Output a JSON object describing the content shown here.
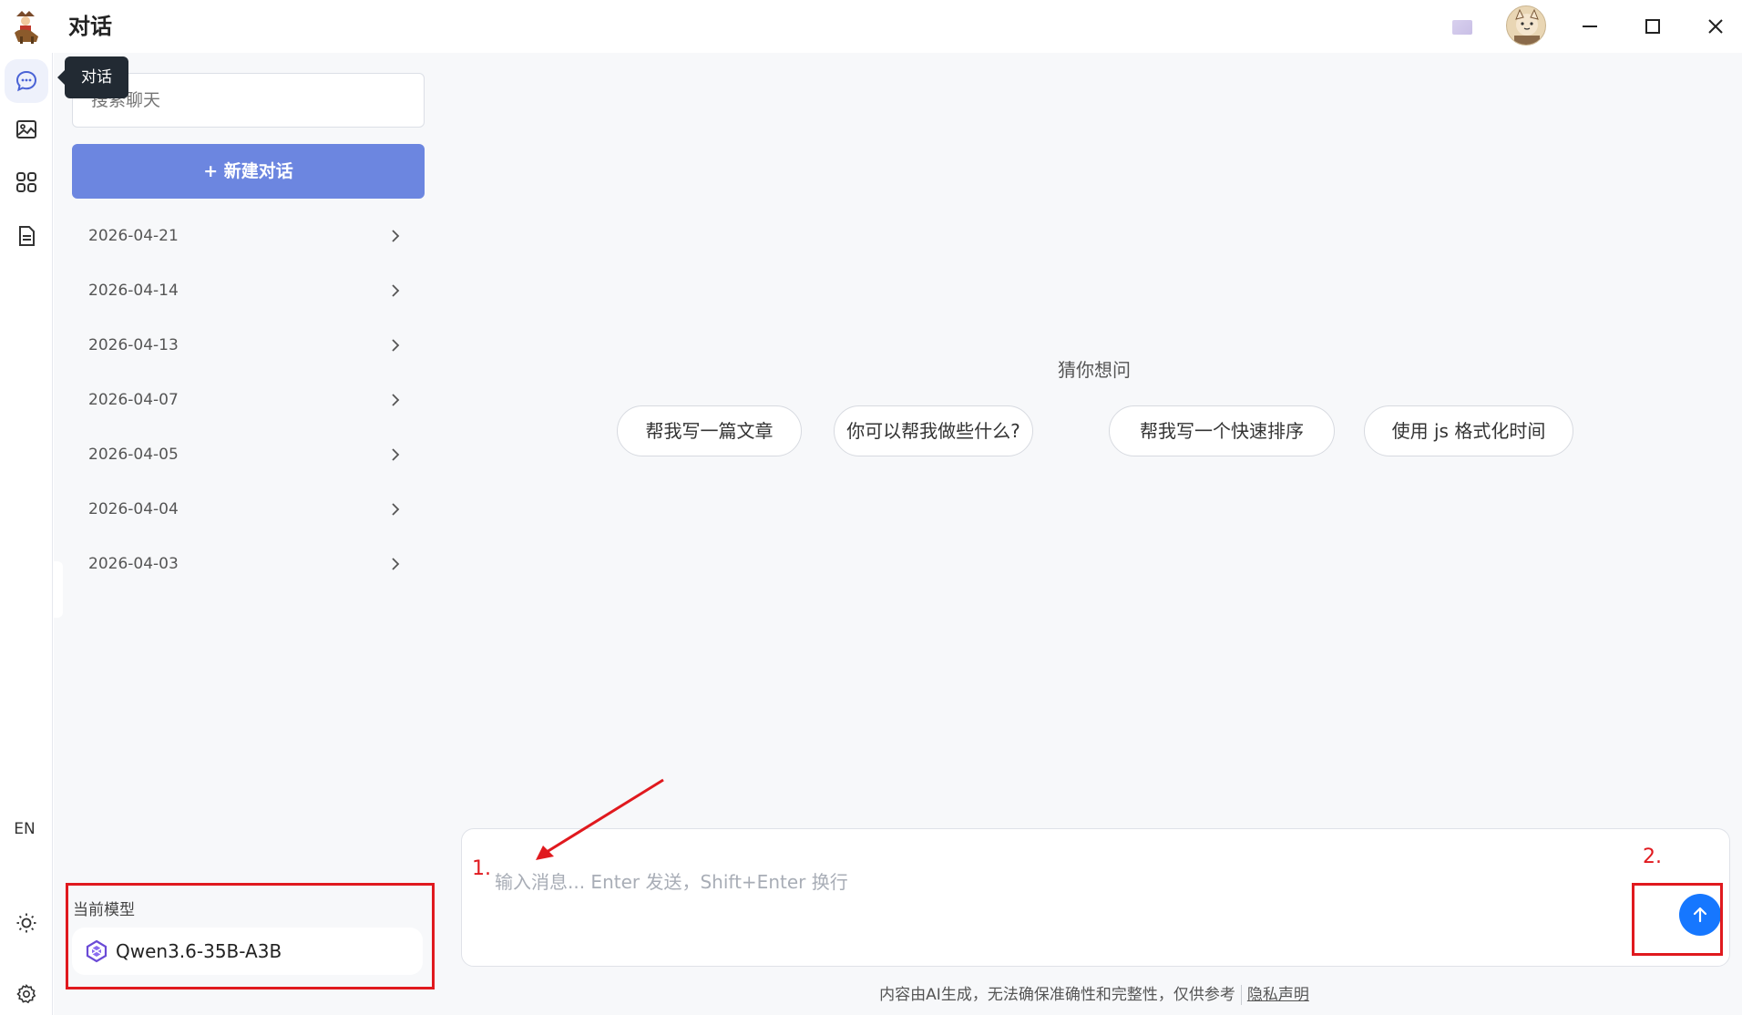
{
  "app": {
    "title": "对话",
    "logo_icon": "cowboy-logo-icon"
  },
  "rail": {
    "items": [
      {
        "name": "chat",
        "icon": "chat-bubble-icon",
        "active": true
      },
      {
        "name": "image",
        "icon": "image-icon",
        "active": false
      },
      {
        "name": "apps",
        "icon": "apps-grid-icon",
        "active": false
      },
      {
        "name": "document",
        "icon": "document-icon",
        "active": false
      }
    ],
    "lang": "EN",
    "theme_icon": "sun-icon",
    "settings_icon": "gear-icon"
  },
  "tooltip": {
    "text": "对话"
  },
  "sidebar": {
    "search_placeholder": "搜索聊天",
    "new_chat_label": "+ 新建对话",
    "history": [
      "2026-04-21",
      "2026-04-14",
      "2026-04-13",
      "2026-04-07",
      "2026-04-05",
      "2026-04-04",
      "2026-04-03"
    ],
    "model_label": "当前模型",
    "model_name": "Qwen3.6-35B-A3B"
  },
  "main": {
    "guess_title": "猜你想问",
    "suggestions": [
      "帮我写一篇文章",
      "你可以帮我做些什么?",
      "帮我写一个快速排序",
      "使用 js 格式化时间"
    ],
    "input_placeholder": "输入消息... Enter 发送，Shift+Enter 换行",
    "disclaimer": "内容由AI生成，无法确保准确性和完整性，仅供参考",
    "privacy_link": "隐私声明"
  },
  "annotations": {
    "step1": "1.",
    "step2": "2."
  },
  "colors": {
    "accent": "#6c86e0",
    "send": "#1677ff",
    "annotation": "#e0191e"
  }
}
